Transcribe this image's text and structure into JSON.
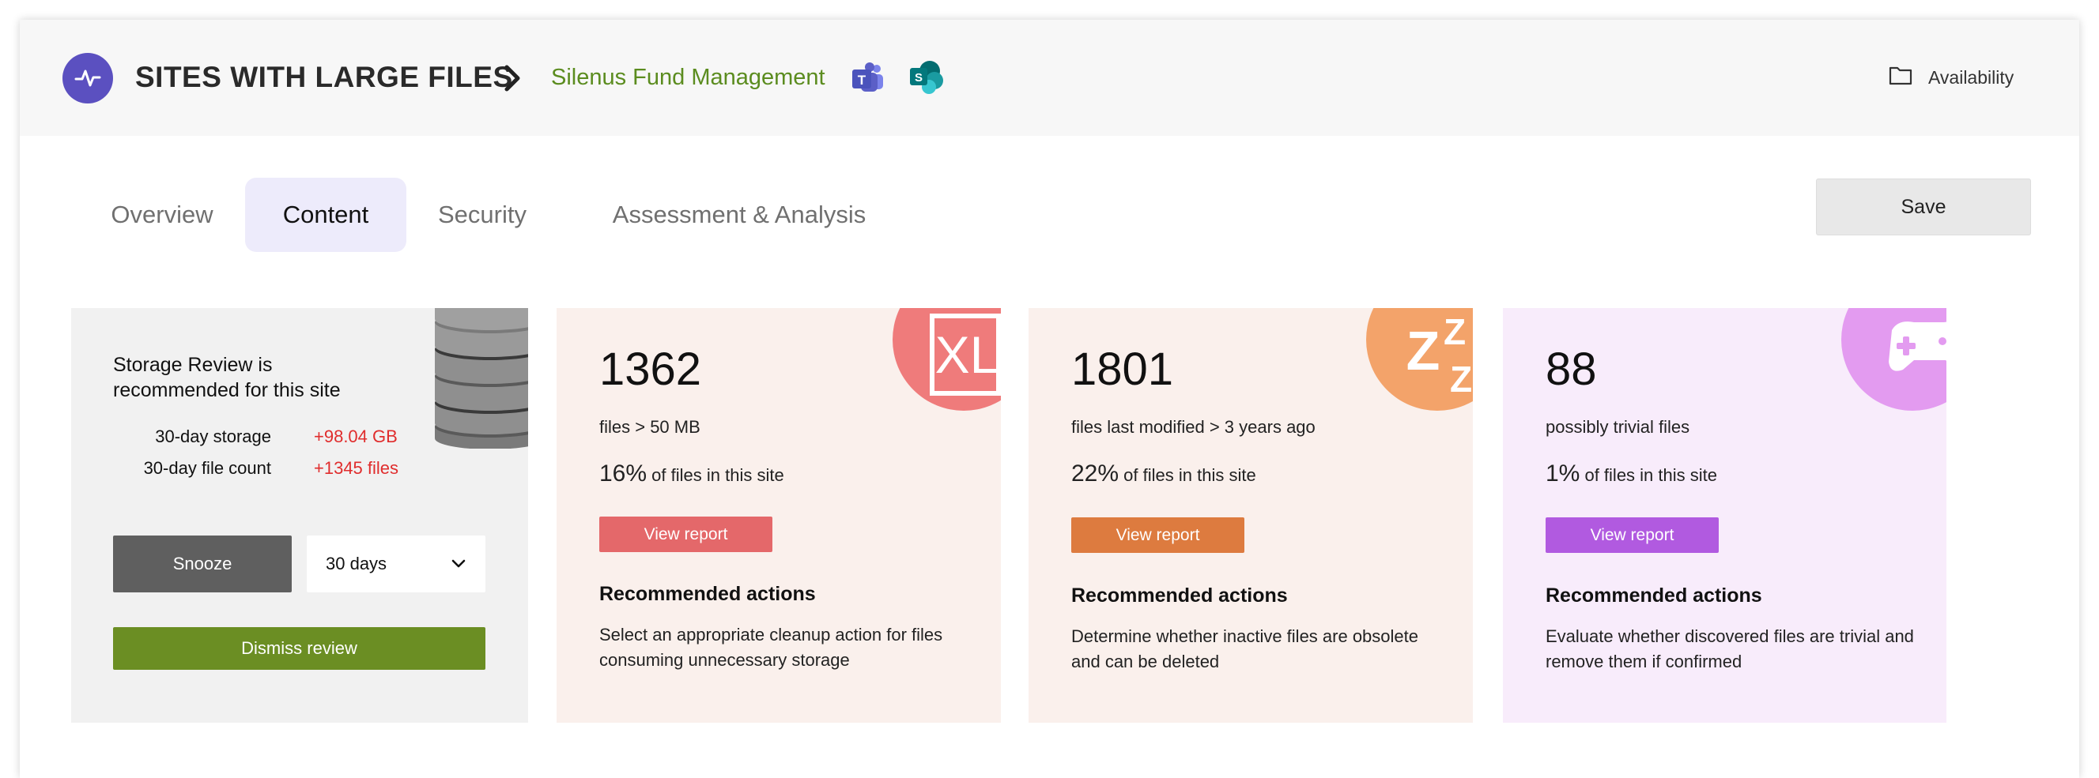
{
  "header": {
    "title": "SITES WITH LARGE FILES",
    "site_name": "Silenus Fund Management",
    "availability_label": "Availability"
  },
  "tabs": [
    {
      "label": "Overview",
      "active": false
    },
    {
      "label": "Content",
      "active": true
    },
    {
      "label": "Security",
      "active": false
    },
    {
      "label": "Assessment & Analysis",
      "active": false
    }
  ],
  "save_label": "Save",
  "review": {
    "title": "Storage Review is recommended for this site",
    "stats": [
      {
        "label": "30-day storage",
        "value": "+98.04 GB"
      },
      {
        "label": "30-day file count",
        "value": "+1345 files"
      }
    ],
    "snooze_label": "Snooze",
    "snooze_duration": "30 days",
    "dismiss_label": "Dismiss review"
  },
  "cards": [
    {
      "icon": "xl-file-icon",
      "count": "1362",
      "description": "files > 50 MB",
      "percent": "16%",
      "percent_suffix": " of files in this site",
      "button_label": "View report",
      "rec_title": "Recommended actions",
      "rec_text": "Select an appropriate cleanup action for files consuming unnecessary storage",
      "colors": {
        "background": "#faf0ec",
        "badge": "#ef7b7b",
        "button": "#e4686a"
      }
    },
    {
      "icon": "sleep-icon",
      "count": "1801",
      "description": "files last modified > 3 years ago",
      "percent": "22%",
      "percent_suffix": " of files in this site",
      "button_label": "View report",
      "rec_title": "Recommended actions",
      "rec_text": "Determine whether inactive files are obsolete and can be deleted",
      "colors": {
        "background": "#faf0ec",
        "badge": "#f3a36a",
        "button": "#dd7b3f"
      }
    },
    {
      "icon": "gamepad-icon",
      "count": "88",
      "description": "possibly trivial files",
      "percent": "1%",
      "percent_suffix": " of files in this site",
      "button_label": "View report",
      "rec_title": "Recommended actions",
      "rec_text": "Evaluate whether discovered files are trivial and remove them if confirmed",
      "colors": {
        "background": "#f8ecfb",
        "badge": "#e39bf0",
        "button": "#b15ae0"
      }
    }
  ]
}
